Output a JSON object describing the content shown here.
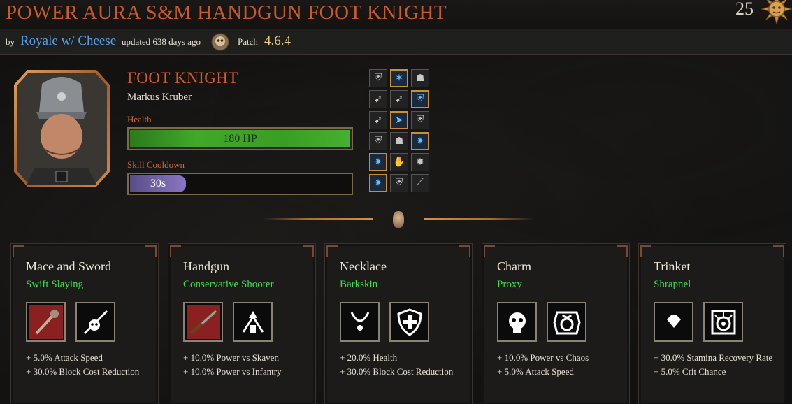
{
  "build": {
    "title": "POWER AURA S&M HANDGUN FOOT KNIGHT",
    "votes": "25"
  },
  "meta": {
    "by_label": "by",
    "author": "Royale w/ Cheese",
    "updated": "updated 638 days ago",
    "patch_label": "Patch",
    "patch_value": "4.6.4"
  },
  "career": {
    "name": "FOOT KNIGHT",
    "hero": "Markus Kruber",
    "health_label": "Health",
    "health_value": "180 HP",
    "cooldown_label": "Skill Cooldown",
    "cooldown_value": "30s"
  },
  "talents": [
    [
      "shield-icon",
      "star-icon-selected",
      "helm-icon"
    ],
    [
      "arrow-icon",
      "arrow-icon",
      "shield-icon-selected"
    ],
    [
      "arrow-icon",
      "dash-icon-selected",
      "shield-icon"
    ],
    [
      "shield-icon",
      "helm-icon",
      "burst-icon-selected"
    ],
    [
      "burst-icon-selected",
      "hand-icon",
      "burst-icon"
    ],
    [
      "burst-icon-selected",
      "shield-icon",
      "slash-icon"
    ]
  ],
  "items": [
    {
      "slot": "Mace and Sword",
      "trait": "Swift Slaying",
      "icon_a": "mace-icon",
      "icon_b": "skull-sword-icon",
      "stats": [
        "+ 5.0% Attack Speed",
        "+ 30.0% Block Cost Reduction"
      ]
    },
    {
      "slot": "Handgun",
      "trait": "Conservative Shooter",
      "icon_a": "handgun-icon",
      "icon_b": "ammo-arrows-icon",
      "stats": [
        "+ 10.0% Power vs Skaven",
        "+ 10.0% Power vs Infantry"
      ]
    },
    {
      "slot": "Necklace",
      "trait": "Barkskin",
      "icon_a": "necklace-icon",
      "icon_b": "cross-shield-icon",
      "stats": [
        "+ 20.0% Health",
        "+ 30.0% Block Cost Reduction"
      ]
    },
    {
      "slot": "Charm",
      "trait": "Proxy",
      "icon_a": "skull-charm-icon",
      "icon_b": "proxy-hand-icon",
      "stats": [
        "+ 10.0% Power vs Chaos",
        "+ 5.0% Attack Speed"
      ]
    },
    {
      "slot": "Trinket",
      "trait": "Shrapnel",
      "icon_a": "gem-icon",
      "icon_b": "shrapnel-icon",
      "stats": [
        "+ 30.0% Stamina Recovery Rate",
        "+ 5.0% Crit Chance"
      ]
    }
  ]
}
